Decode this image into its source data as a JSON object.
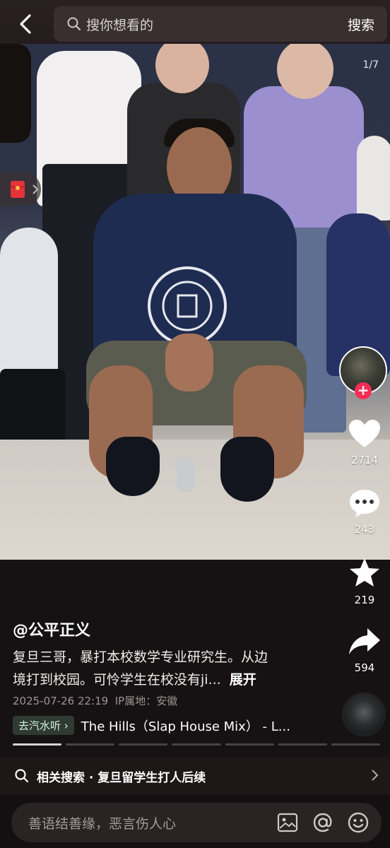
{
  "topbar": {
    "search_placeholder": "搜你想看的",
    "search_button": "搜索"
  },
  "photo": {
    "counter": "1/7"
  },
  "actions": {
    "likes": "2714",
    "comments": "243",
    "favorites": "219",
    "shares": "594"
  },
  "post": {
    "author": "@公平正义",
    "desc_line1": "复旦三哥，暴打本校数学专业研究生。从边",
    "desc_line2": "境打到校园。可怜学生在校没有ji...",
    "expand": "展开",
    "time": "2025-07-26 22:19",
    "ip_label": "IP属地：安徽"
  },
  "music": {
    "tag": "去汽水听",
    "title": "The Hills（Slap House Mix） - L..."
  },
  "related": {
    "text": "相关搜索 · 复旦留学生打人后续"
  },
  "comment": {
    "placeholder": "善语结善缘，恶言伤人心"
  },
  "progress": {
    "total": 7,
    "current": 1
  },
  "icons": [
    "back-icon",
    "search-icon",
    "red-packet-icon",
    "heart-icon",
    "comment-icon",
    "star-icon",
    "share-icon",
    "image-icon",
    "at-icon",
    "emoji-icon",
    "chevron-right-icon"
  ],
  "colors": {
    "accent": "#fe2c55",
    "background": "#161213"
  }
}
